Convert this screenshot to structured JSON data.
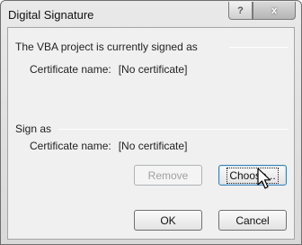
{
  "window": {
    "title": "Digital Signature",
    "help_glyph": "?",
    "close_glyph": "x"
  },
  "current": {
    "heading": "The VBA project is currently signed as",
    "cert_label": "Certificate name:",
    "cert_value": "[No certificate]"
  },
  "sign_as": {
    "heading": "Sign as",
    "cert_label": "Certificate name:",
    "cert_value": "[No certificate]"
  },
  "buttons": {
    "remove": "Remove",
    "choose": "Choose...",
    "ok": "OK",
    "cancel": "Cancel"
  },
  "state": {
    "remove_enabled": false,
    "focused_button": "choose"
  }
}
